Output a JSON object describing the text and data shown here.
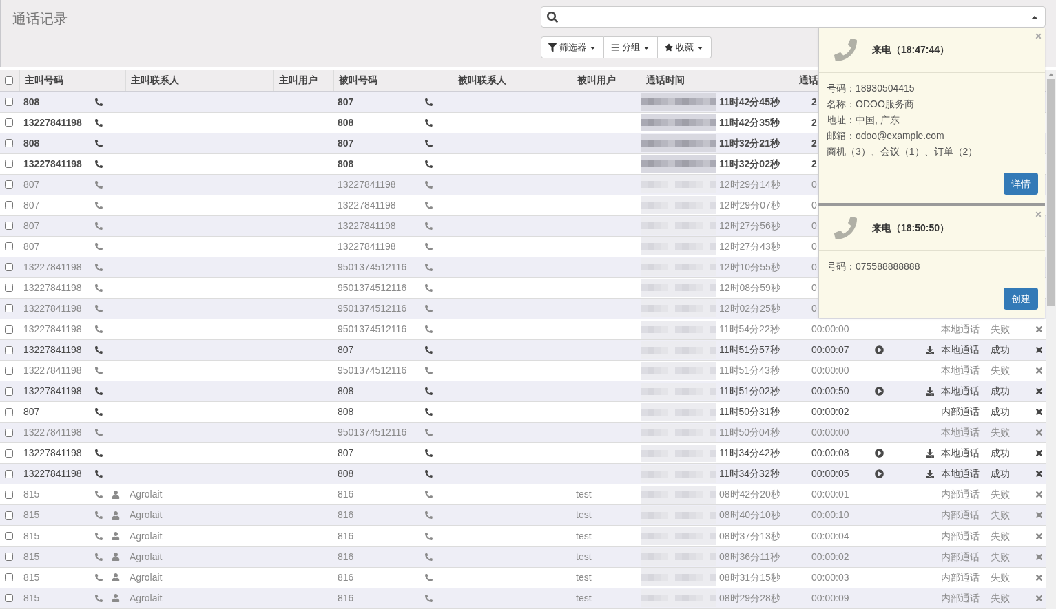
{
  "title": "通话记录",
  "select_all": {
    "checked": false
  },
  "filter_buttons": [
    {
      "kind": "filter",
      "label": "筛选器"
    },
    {
      "kind": "group",
      "label": "分组"
    },
    {
      "kind": "favorite",
      "label": "收藏"
    }
  ],
  "columns": [
    "主叫号码",
    "主叫联系人",
    "主叫用户",
    "被叫号码",
    "被叫联系人",
    "被叫用户",
    "通话时间",
    "通话"
  ],
  "rows": [
    {
      "caller": "808",
      "callee": "807",
      "time": "11时42分45秒",
      "duration": "2",
      "unread": true,
      "muted": false,
      "recording": false
    },
    {
      "caller": "13227841198",
      "callee": "808",
      "time": "11时42分35秒",
      "duration": "2",
      "unread": true,
      "muted": false,
      "recording": false
    },
    {
      "caller": "808",
      "callee": "807",
      "time": "11时32分21秒",
      "duration": "2",
      "unread": true,
      "muted": false,
      "recording": false
    },
    {
      "caller": "13227841198",
      "callee": "808",
      "time": "11时32分02秒",
      "duration": "2",
      "unread": true,
      "muted": false,
      "recording": false
    },
    {
      "caller": "807",
      "callee": "13227841198",
      "time": "12时29分14秒",
      "duration": "0",
      "unread": false,
      "muted": true,
      "recording": false
    },
    {
      "caller": "807",
      "callee": "13227841198",
      "time": "12时29分07秒",
      "duration": "0",
      "unread": false,
      "muted": true,
      "recording": false
    },
    {
      "caller": "807",
      "callee": "13227841198",
      "time": "12时27分56秒",
      "duration": "0",
      "unread": false,
      "muted": true,
      "recording": false
    },
    {
      "caller": "807",
      "callee": "13227841198",
      "time": "12时27分43秒",
      "duration": "0",
      "unread": false,
      "muted": true,
      "recording": false
    },
    {
      "caller": "13227841198",
      "callee": "9501374512116",
      "time": "12时10分55秒",
      "duration": "0",
      "unread": false,
      "muted": true,
      "recording": false
    },
    {
      "caller": "13227841198",
      "callee": "9501374512116",
      "time": "12时08分59秒",
      "duration": "0",
      "unread": false,
      "muted": true,
      "recording": false
    },
    {
      "caller": "13227841198",
      "callee": "9501374512116",
      "time": "12时02分25秒",
      "duration": "0",
      "unread": false,
      "muted": true,
      "recording": false
    },
    {
      "caller": "13227841198",
      "callee": "9501374512116",
      "time": "11时54分22秒",
      "duration": "00:00:00",
      "type": "本地通话",
      "status": "失败",
      "unread": false,
      "muted": true,
      "recording": false
    },
    {
      "caller": "13227841198",
      "callee": "807",
      "time": "11时51分57秒",
      "duration": "00:00:07",
      "type": "本地通话",
      "status": "成功",
      "unread": false,
      "muted": false,
      "recording": true
    },
    {
      "caller": "13227841198",
      "callee": "9501374512116",
      "time": "11时51分43秒",
      "duration": "00:00:00",
      "type": "本地通话",
      "status": "失败",
      "unread": false,
      "muted": true,
      "recording": false
    },
    {
      "caller": "13227841198",
      "callee": "808",
      "time": "11时51分02秒",
      "duration": "00:00:50",
      "type": "本地通话",
      "status": "成功",
      "unread": false,
      "muted": false,
      "recording": true
    },
    {
      "caller": "807",
      "callee": "808",
      "time": "11时50分31秒",
      "duration": "00:00:02",
      "type": "内部通话",
      "status": "成功",
      "unread": false,
      "muted": false,
      "recording": false
    },
    {
      "caller": "13227841198",
      "callee": "9501374512116",
      "time": "11时50分04秒",
      "duration": "00:00:00",
      "type": "本地通话",
      "status": "失败",
      "unread": false,
      "muted": true,
      "recording": false
    },
    {
      "caller": "13227841198",
      "callee": "807",
      "time": "11时34分42秒",
      "duration": "00:00:08",
      "type": "本地通话",
      "status": "成功",
      "unread": false,
      "muted": false,
      "recording": true
    },
    {
      "caller": "13227841198",
      "callee": "808",
      "time": "11时34分32秒",
      "duration": "00:00:05",
      "type": "本地通话",
      "status": "成功",
      "unread": false,
      "muted": false,
      "recording": true
    },
    {
      "caller": "815",
      "caller_contact": "Agrolait",
      "callee": "816",
      "callee_user": "test",
      "time": "08时42分20秒",
      "duration": "00:00:01",
      "type": "内部通话",
      "status": "失败",
      "unread": false,
      "muted": true,
      "recording": false
    },
    {
      "caller": "815",
      "caller_contact": "Agrolait",
      "callee": "816",
      "callee_user": "test",
      "time": "08时40分10秒",
      "duration": "00:00:10",
      "type": "内部通话",
      "status": "失败",
      "unread": false,
      "muted": true,
      "recording": false
    },
    {
      "caller": "815",
      "caller_contact": "Agrolait",
      "callee": "816",
      "callee_user": "test",
      "time": "08时37分13秒",
      "duration": "00:00:04",
      "type": "内部通话",
      "status": "失败",
      "unread": false,
      "muted": true,
      "recording": false
    },
    {
      "caller": "815",
      "caller_contact": "Agrolait",
      "callee": "816",
      "callee_user": "test",
      "time": "08时36分11秒",
      "duration": "00:00:02",
      "type": "内部通话",
      "status": "失败",
      "unread": false,
      "muted": true,
      "recording": false
    },
    {
      "caller": "815",
      "caller_contact": "Agrolait",
      "callee": "816",
      "callee_user": "test",
      "time": "08时31分15秒",
      "duration": "00:00:03",
      "type": "内部通话",
      "status": "失败",
      "unread": false,
      "muted": true,
      "recording": false
    },
    {
      "caller": "815",
      "caller_contact": "Agrolait",
      "callee": "816",
      "callee_user": "test",
      "time": "08时29分28秒",
      "duration": "00:00:09",
      "type": "内部通话",
      "status": "失败",
      "unread": false,
      "muted": true,
      "recording": false
    }
  ],
  "notifications": [
    {
      "title": "来电（18:47:44）",
      "lines": [
        "号码：18930504415",
        "名称：ODOO服务商",
        "地址：中国, 广东",
        "邮箱：odoo@example.com",
        "商机（3）、会议（1）、订单（2）"
      ],
      "button": "详情"
    },
    {
      "title": "来电（18:50:50）",
      "lines": [
        "号码：075588888888"
      ],
      "button": "创建"
    }
  ]
}
